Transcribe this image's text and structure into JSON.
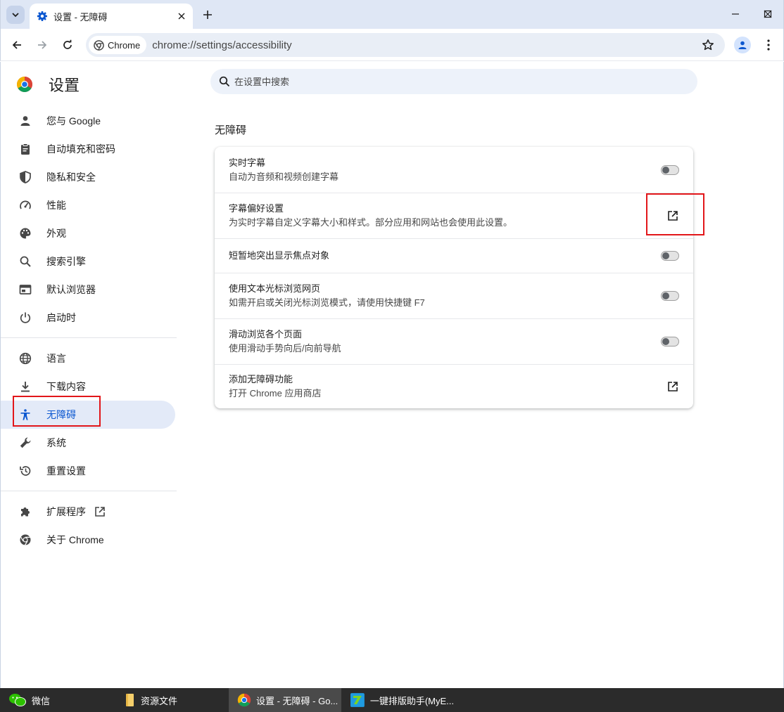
{
  "browser": {
    "tab_title": "设置 - 无障碍",
    "omnibox_chip": "Chrome",
    "url": "chrome://settings/accessibility"
  },
  "settings": {
    "title": "设置",
    "search_placeholder": "在设置中搜索",
    "nav": [
      {
        "label": "您与 Google",
        "icon": "person-icon"
      },
      {
        "label": "自动填充和密码",
        "icon": "clipboard-icon"
      },
      {
        "label": "隐私和安全",
        "icon": "shield-icon"
      },
      {
        "label": "性能",
        "icon": "speedometer-icon"
      },
      {
        "label": "外观",
        "icon": "palette-icon"
      },
      {
        "label": "搜索引擎",
        "icon": "search-icon"
      },
      {
        "label": "默认浏览器",
        "icon": "browser-icon"
      },
      {
        "label": "启动时",
        "icon": "power-icon"
      },
      {
        "label": "语言",
        "icon": "globe-icon"
      },
      {
        "label": "下载内容",
        "icon": "download-icon"
      },
      {
        "label": "无障碍",
        "icon": "accessibility-icon"
      },
      {
        "label": "系统",
        "icon": "wrench-icon"
      },
      {
        "label": "重置设置",
        "icon": "history-icon"
      },
      {
        "label": "扩展程序",
        "icon": "puzzle-icon"
      },
      {
        "label": "关于 Chrome",
        "icon": "chrome-icon"
      }
    ],
    "active_nav": "无障碍",
    "section_title": "无障碍",
    "rows": [
      {
        "title": "实时字幕",
        "subtitle": "自动为音频和视频创建字幕",
        "control": "toggle",
        "on": false
      },
      {
        "title": "字幕偏好设置",
        "subtitle": "为实时字幕自定义字幕大小和样式。部分应用和网站也会使用此设置。",
        "control": "launch"
      },
      {
        "title": "短暂地突出显示焦点对象",
        "subtitle": "",
        "control": "toggle",
        "on": false
      },
      {
        "title": "使用文本光标浏览网页",
        "subtitle": "如需开启或关闭光标浏览模式，请使用快捷键 F7",
        "control": "toggle",
        "on": false
      },
      {
        "title": "滑动浏览各个页面",
        "subtitle": "使用滑动手势向后/向前导航",
        "control": "toggle",
        "on": false
      },
      {
        "title": "添加无障碍功能",
        "subtitle": "打开 Chrome 应用商店",
        "control": "launch"
      }
    ]
  },
  "taskbar": [
    {
      "label": "微信",
      "icon": "wechat-icon"
    },
    {
      "label": "资源文件",
      "icon": "folder-icon"
    },
    {
      "label": "设置 - 无障碍 - Go...",
      "icon": "chrome-icon"
    },
    {
      "label": "一键排版助手(MyE...",
      "icon": "app-icon"
    }
  ],
  "colors": {
    "accent": "#0b57d0",
    "highlight_box": "#e2161a",
    "active_nav_bg": "#e3eaf8"
  }
}
